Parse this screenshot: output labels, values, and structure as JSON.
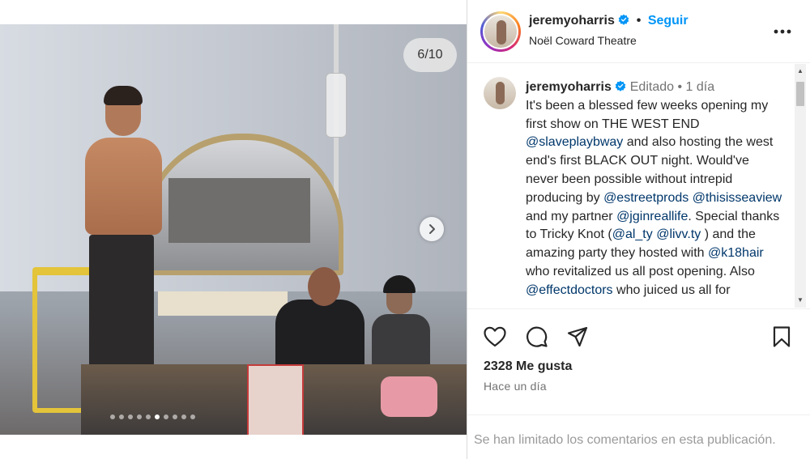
{
  "media": {
    "counter": "6/10",
    "total_slides": 10,
    "current_slide": 6
  },
  "header": {
    "username": "jeremyoharris",
    "separator": "•",
    "follow_label": "Seguir",
    "location": "Noël Coward Theatre"
  },
  "caption": {
    "username": "jeremyoharris",
    "edited_label": "Editado",
    "separator": "•",
    "age": "1 día",
    "segments": [
      {
        "t": "It's been a blessed few weeks opening my first show on THE WEST END ",
        "m": false
      },
      {
        "t": "@slaveplaybway",
        "m": true
      },
      {
        "t": " and also hosting the west end's first BLACK OUT night. Would've never been possible without intrepid producing by ",
        "m": false
      },
      {
        "t": "@estreetprods",
        "m": true
      },
      {
        "t": " ",
        "m": false
      },
      {
        "t": "@thisisseaview",
        "m": true
      },
      {
        "t": " and my partner ",
        "m": false
      },
      {
        "t": "@jginreallife",
        "m": true
      },
      {
        "t": ". Special thanks to Tricky Knot (",
        "m": false
      },
      {
        "t": "@al_ty",
        "m": true
      },
      {
        "t": " ",
        "m": false
      },
      {
        "t": "@livv.ty",
        "m": true
      },
      {
        "t": " ) and the amazing party they hosted with ",
        "m": false
      },
      {
        "t": "@k18hair",
        "m": true
      },
      {
        "t": " who revitalized us all post opening. Also ",
        "m": false
      },
      {
        "t": "@effectdoctors",
        "m": true
      },
      {
        "t": " who juiced us all for",
        "m": false
      }
    ]
  },
  "actions": {
    "like_icon": "heart-icon",
    "comment_icon": "comment-bubble-icon",
    "share_icon": "paper-plane-icon",
    "save_icon": "bookmark-icon"
  },
  "stats": {
    "likes": "2328 Me gusta",
    "time": "Hace un día"
  },
  "footer": {
    "comments_limited": "Se han limitado los comentarios en esta publicación."
  },
  "colors": {
    "accent": "#0095f6",
    "mention": "#00376b",
    "muted": "#737373",
    "text": "#262626"
  }
}
